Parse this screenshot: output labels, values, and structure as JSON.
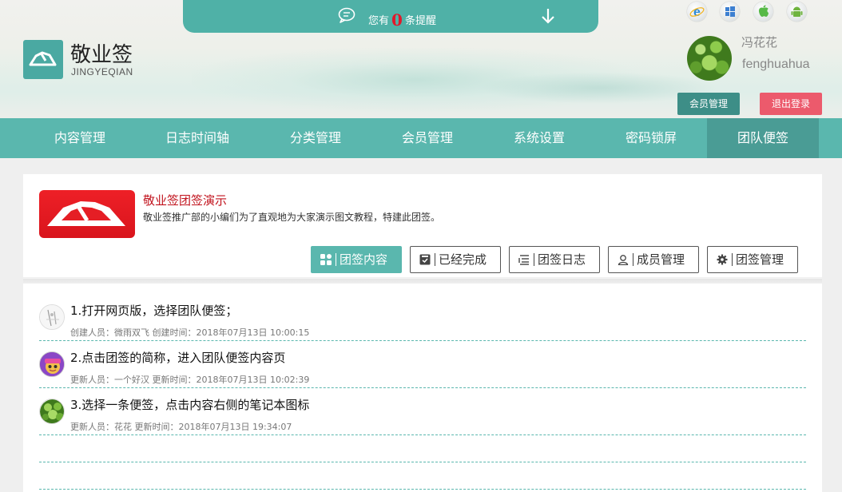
{
  "notification": {
    "prefix": "您有",
    "count": "0",
    "suffix": "条提醒"
  },
  "brand": {
    "title": "敬业签",
    "subtitle": "JINGYEQIAN"
  },
  "platforms": [
    "ie-icon",
    "windows-icon",
    "apple-icon",
    "android-icon"
  ],
  "user": {
    "name_cn": "冯花花",
    "name_en": "fenghuahua",
    "member_btn": "会员管理",
    "logout_btn": "退出登录"
  },
  "nav": {
    "items": [
      {
        "label": "内容管理"
      },
      {
        "label": "日志时间轴"
      },
      {
        "label": "分类管理"
      },
      {
        "label": "会员管理"
      },
      {
        "label": "系统设置"
      },
      {
        "label": "密码锁屏"
      },
      {
        "label": "团队便签"
      }
    ],
    "active_index": 6
  },
  "team": {
    "title": "敬业签团签演示",
    "description": "敬业签推广部的小编们为了直观地为大家演示图文教程，特建此团签。",
    "tabs": [
      {
        "label": "团签内容",
        "icon": "grid-icon"
      },
      {
        "label": "已经完成",
        "icon": "check-box-icon"
      },
      {
        "label": "团签日志",
        "icon": "log-list-icon"
      },
      {
        "label": "成员管理",
        "icon": "user-icon"
      },
      {
        "label": "团签管理",
        "icon": "gear-icon"
      }
    ],
    "active_tab": 0
  },
  "notes": [
    {
      "title": "1.打开网页版，选择团队便签；",
      "meta": "创建人员：微雨双飞 创建时间：2018年07月13日 10:00:15"
    },
    {
      "title": "2.点击团签的简称，进入团队便签内容页",
      "meta": "更新人员：一个好汉 更新时间：2018年07月13日 10:02:39"
    },
    {
      "title": "3.选择一条便签，点击内容右侧的笔记本图标",
      "meta": "更新人员：花花 更新时间：2018年07月13日 19:34:07"
    }
  ],
  "colors": {
    "accent": "#5ab7ae",
    "accent_dark": "#4a9c95",
    "logout": "#ec5a6c",
    "brand_red": "#e51e25"
  }
}
